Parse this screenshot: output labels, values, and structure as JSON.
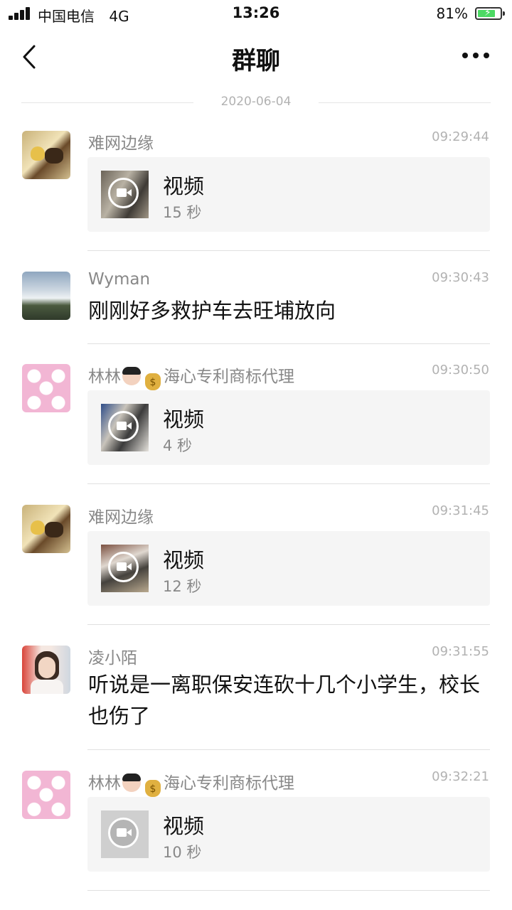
{
  "status_bar": {
    "carrier": "中国电信",
    "network": "4G",
    "time": "13:26",
    "battery_percent": "81%",
    "battery_level": 0.81
  },
  "nav": {
    "title": "群聊"
  },
  "date_divider": "2020-06-04",
  "messages": [
    {
      "sender": "难网边缘",
      "time": "09:29:44",
      "type": "video",
      "title": "视频",
      "duration": "15 秒"
    },
    {
      "sender": "Wyman",
      "time": "09:30:43",
      "type": "text",
      "text": "刚刚好多救护车去旺埔放向"
    },
    {
      "sender_name": "林林",
      "sender_suffix": "海心专利商标代理",
      "time": "09:30:50",
      "type": "video",
      "title": "视频",
      "duration": "4 秒"
    },
    {
      "sender": "难网边缘",
      "time": "09:31:45",
      "type": "video",
      "title": "视频",
      "duration": "12 秒"
    },
    {
      "sender": "凌小陌",
      "time": "09:31:55",
      "type": "text",
      "text": "听说是一离职保安连砍十几个小学生，校长也伤了"
    },
    {
      "sender_name": "林林",
      "sender_suffix": "海心专利商标代理",
      "time": "09:32:21",
      "type": "video",
      "title": "视频",
      "duration": "10 秒"
    }
  ],
  "icons": {
    "back": "chevron-left-icon",
    "more": "more-dots-icon",
    "video": "video-camera-icon"
  },
  "colors": {
    "card_bg": "#f5f5f5",
    "battery": "#4cd964",
    "muted_text": "#888888"
  }
}
